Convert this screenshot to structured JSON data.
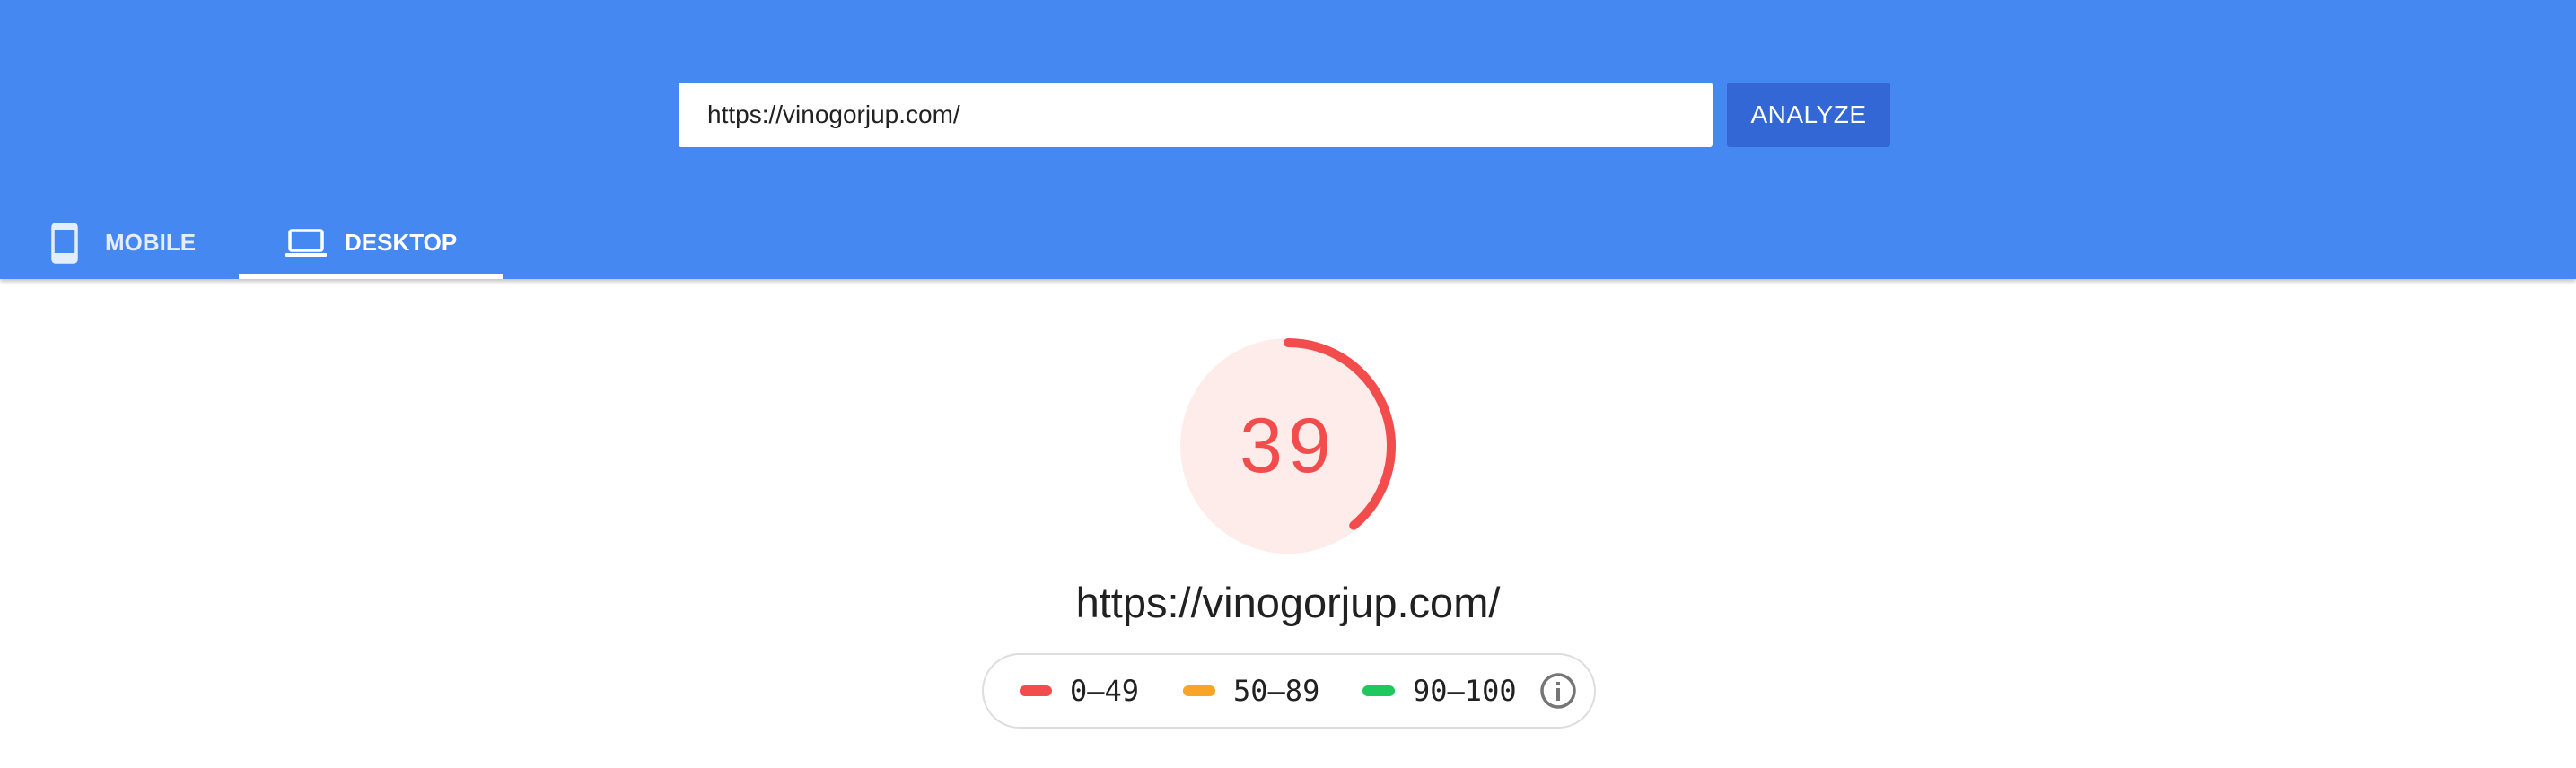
{
  "search": {
    "url_value": "https://vinogorjup.com/",
    "analyze_label": "ANALYZE"
  },
  "tabs": [
    {
      "label": "MOBILE",
      "icon": "smartphone-icon",
      "selected": false
    },
    {
      "label": "DESKTOP",
      "icon": "laptop-icon",
      "selected": true
    }
  ],
  "score": {
    "value": "39",
    "fraction": 0.39,
    "color": "#f24c4c",
    "track_color": "#fdecea"
  },
  "page_url": "https://vinogorjup.com/",
  "legend": [
    {
      "range": "0–49",
      "color": "#f24c4c"
    },
    {
      "range": "50–89",
      "color": "#f7a427"
    },
    {
      "range": "90–100",
      "color": "#1ec85f"
    }
  ],
  "colors": {
    "header": "#4688f1",
    "analyze_button": "#3367d6"
  },
  "info_icon": "info-icon"
}
